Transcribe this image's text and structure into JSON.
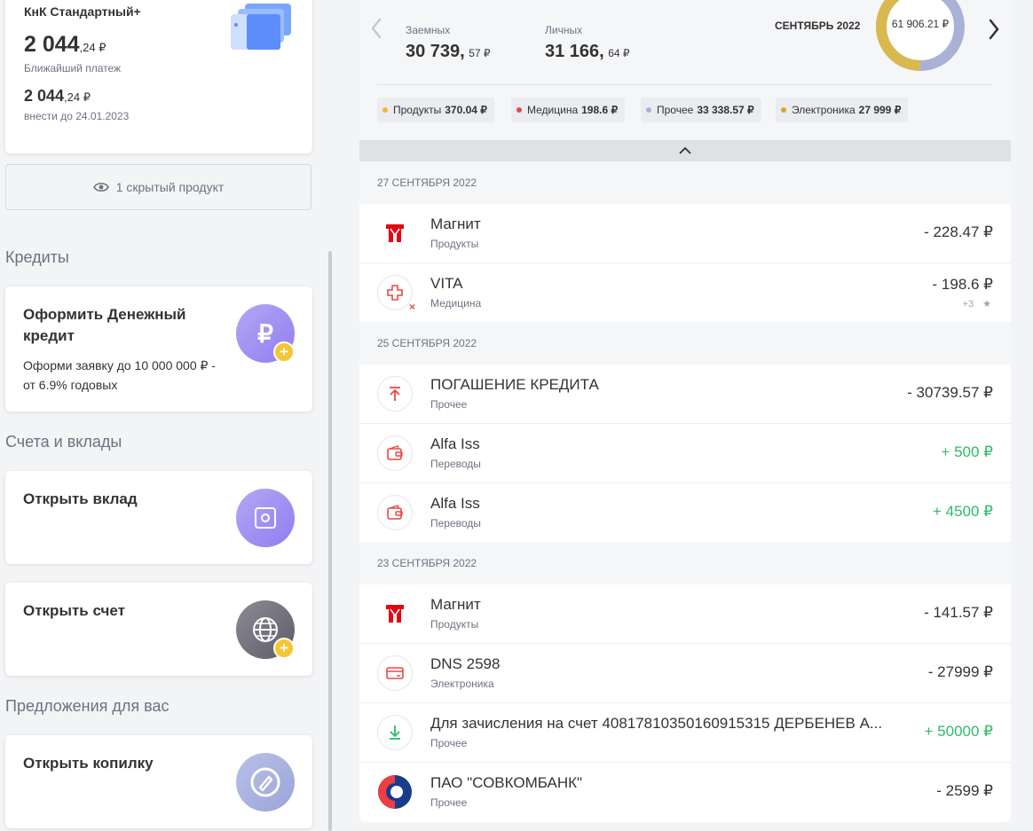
{
  "product_card": {
    "title": "КнК Стандартный+",
    "amount_main": "2 044",
    "amount_fraction": ",24 ₽",
    "amount_label": "Ближайший платеж",
    "amount2_main": "2 044",
    "amount2_fraction": ",24 ₽",
    "due_label": "внести до 24.01.2023"
  },
  "hidden_products": "1 скрытый продукт",
  "sections": {
    "credits": "Кредиты",
    "accounts": "Счета и вклады",
    "offers": "Предложения для вас"
  },
  "credit_card": {
    "title": "Оформить Денежный кредит",
    "desc": "Оформи заявку до 10 000 000 ₽ - от 6.9% годовых"
  },
  "deposit_card": {
    "title": "Открыть вклад"
  },
  "account_card": {
    "title": "Открыть счет"
  },
  "piggy_card": {
    "title": "Открыть копилку"
  },
  "summary": {
    "borrowed_label": "Заемных",
    "borrowed_main": "30 739,",
    "borrowed_fraction": "57 ₽",
    "own_label": "Личных",
    "own_main": "31 166,",
    "own_fraction": "64 ₽",
    "month": "СЕНТЯБРЬ 2022",
    "donut_total": "61 906.21 ₽",
    "donut_borrowed_fraction": 0.4966,
    "donut_colors": {
      "borrowed": "#d9b84f",
      "own": "#a9b1d6"
    },
    "categories": [
      {
        "label": "Продукты",
        "value": "370.04 ₽",
        "color": "#f2b824"
      },
      {
        "label": "Медицина",
        "value": "198.6 ₽",
        "color": "#e84848"
      },
      {
        "label": "Прочее",
        "value": "33 338.57 ₽",
        "color": "#a9b1d6"
      },
      {
        "label": "Электроника",
        "value": "27 999 ₽",
        "color": "#d3a82a"
      }
    ]
  },
  "groups": [
    {
      "date": "27 СЕНТЯБРЯ 2022",
      "items": [
        {
          "name": "Магнит",
          "category": "Продукты",
          "amount": "- 228.47 ₽",
          "icon": "magnit-logo-icon"
        },
        {
          "name": "VITA",
          "category": "Медицина",
          "amount": "- 198.6 ₽",
          "extra": "+3",
          "icon": "medical-cross-icon"
        }
      ]
    },
    {
      "date": "25 СЕНТЯБРЯ 2022",
      "items": [
        {
          "name": "ПОГАШЕНИЕ КРЕДИТА",
          "category": "Прочее",
          "amount": "- 30739.57 ₽",
          "icon": "upload-arrow-icon"
        },
        {
          "name": "Alfa Iss",
          "category": "Переводы",
          "amount": "+ 500 ₽",
          "positive": true,
          "icon": "wallet-icon"
        },
        {
          "name": "Alfa Iss",
          "category": "Переводы",
          "amount": "+ 4500 ₽",
          "positive": true,
          "icon": "wallet-icon"
        }
      ]
    },
    {
      "date": "23 СЕНТЯБРЯ 2022",
      "items": [
        {
          "name": "Магнит",
          "category": "Продукты",
          "amount": "- 141.57 ₽",
          "icon": "magnit-logo-icon"
        },
        {
          "name": "DNS 2598",
          "category": "Электроника",
          "amount": "- 27999 ₽",
          "icon": "card-icon"
        },
        {
          "name": "Для зачисления на счет 40817810350160915315 ДЕРБЕНЕВ А...",
          "category": "Прочее",
          "amount": "+ 50000 ₽",
          "positive": true,
          "icon": "download-arrow-icon"
        },
        {
          "name": "ПАО \"СОВКОМБАНК\"",
          "category": "Прочее",
          "amount": "- 2599 ₽",
          "icon": "sovcombank-logo-icon"
        }
      ]
    }
  ]
}
